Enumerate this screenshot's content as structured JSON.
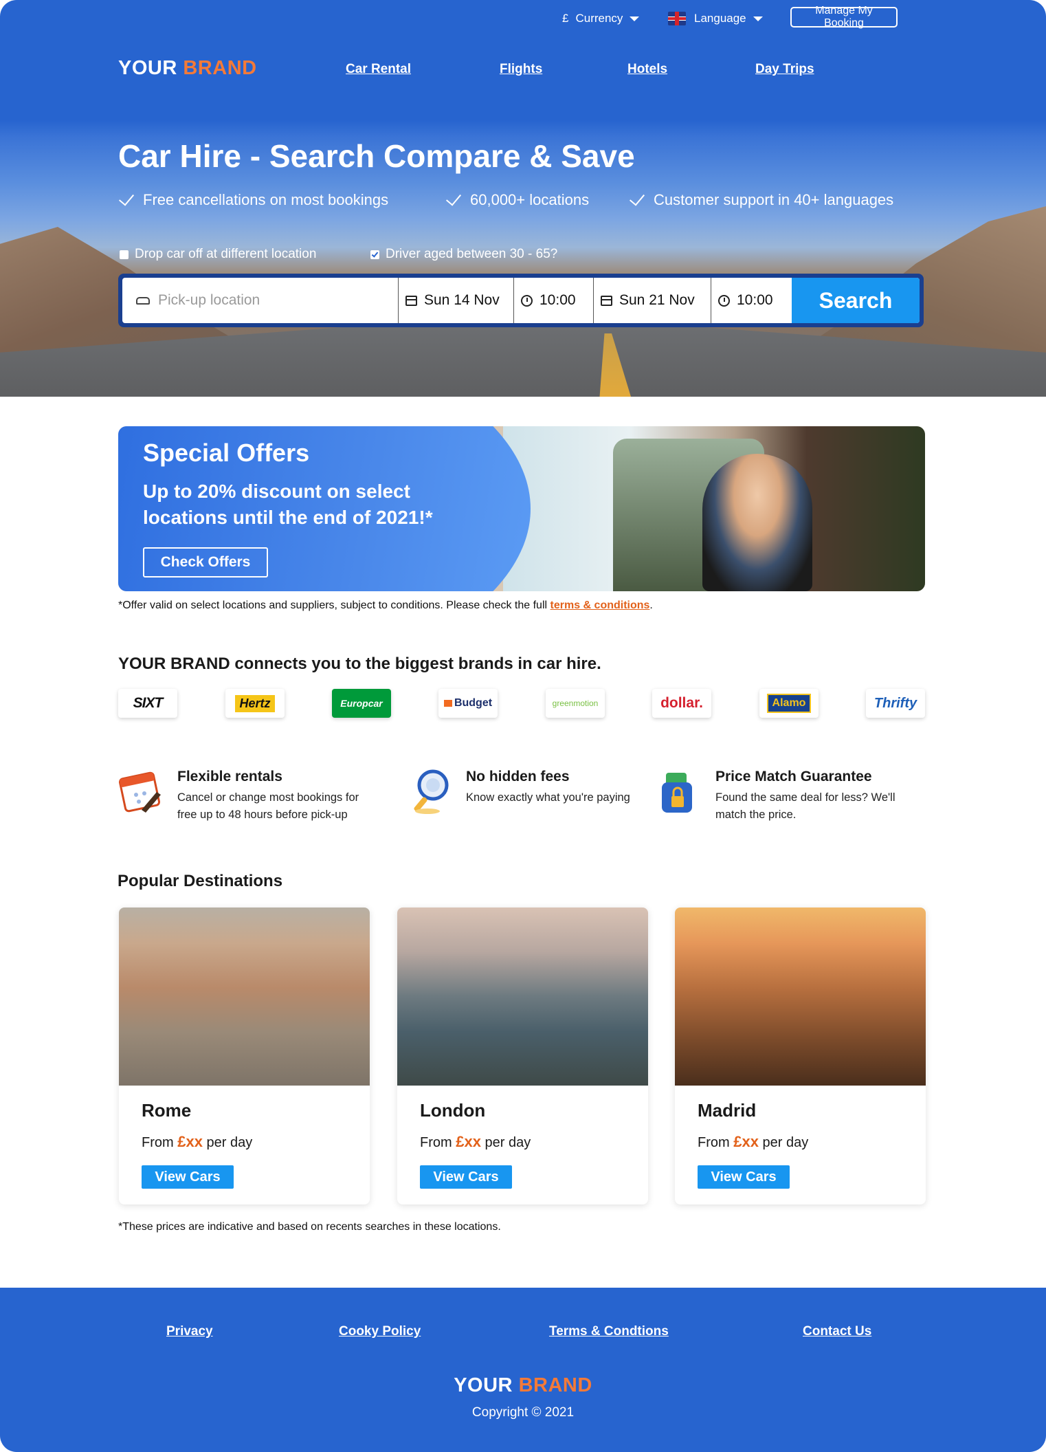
{
  "topbar": {
    "currency_symbol": "£",
    "currency_label": "Currency",
    "language_label": "Language",
    "manage_booking": "Manage My Booking"
  },
  "brand": {
    "part1": "YOUR",
    "part2": "BRAND"
  },
  "nav": [
    "Car Rental",
    "Flights",
    "Hotels",
    "Day Trips"
  ],
  "hero": {
    "title": "Car Hire - Search Compare & Save",
    "usps": [
      "Free cancellations on most bookings",
      "60,000+ locations",
      "Customer support in 40+ languages"
    ],
    "options": [
      {
        "label": "Drop car off at different location",
        "checked": false
      },
      {
        "label": "Driver aged between 30 - 65?",
        "checked": true
      }
    ]
  },
  "search": {
    "pickup_placeholder": "Pick-up location",
    "pickup_date": "Sun 14 Nov",
    "pickup_time": "10:00",
    "dropoff_date": "Sun 21 Nov",
    "dropoff_time": "10:00",
    "button": "Search"
  },
  "offer": {
    "title": "Special Offers",
    "text": "Up to 20% discount on select locations until the end of 2021!*",
    "button": "Check Offers",
    "fine_print": "*Offer valid on select locations and suppliers, subject to conditions. Please check the full",
    "terms_link": "terms & conditions",
    "fine_end": "."
  },
  "brands": {
    "title": "YOUR BRAND connects you to the biggest brands in car hire.",
    "logos": [
      "SIXT",
      "Hertz",
      "Europcar",
      "Budget",
      "greenmotion",
      "dollar.",
      "Alamo",
      "Thrifty"
    ]
  },
  "features": [
    {
      "title": "Flexible rentals",
      "text": "Cancel or change most bookings for free up to 48 hours before pick-up",
      "icon": "calendar-icon"
    },
    {
      "title": "No hidden fees",
      "text": "Know exactly what you're paying",
      "icon": "magnifier-icon"
    },
    {
      "title": "Price Match Guarantee",
      "text": "Found the same deal for less? We'll match the price.",
      "icon": "wallet-lock-icon"
    }
  ],
  "destinations": {
    "title": "Popular Destinations",
    "items": [
      {
        "name": "Rome",
        "from": "From",
        "price": "£xx",
        "per": "per day",
        "button": "View Cars"
      },
      {
        "name": "London",
        "from": "From",
        "price": "£xx",
        "per": "per day",
        "button": "View Cars"
      },
      {
        "name": "Madrid",
        "from": "From",
        "price": "£xx",
        "per": "per day",
        "button": "View Cars"
      }
    ],
    "fine_print": "*These prices are indicative and based on recents searches in these locations."
  },
  "footer": {
    "links": [
      "Privacy",
      "Cooky Policy",
      "Terms & Condtions",
      "Contact Us"
    ],
    "copyright": "Copyright © 2021"
  },
  "colors": {
    "primary": "#2764cf",
    "accent": "#f47a38",
    "button": "#1896f0",
    "price": "#e2611a"
  }
}
